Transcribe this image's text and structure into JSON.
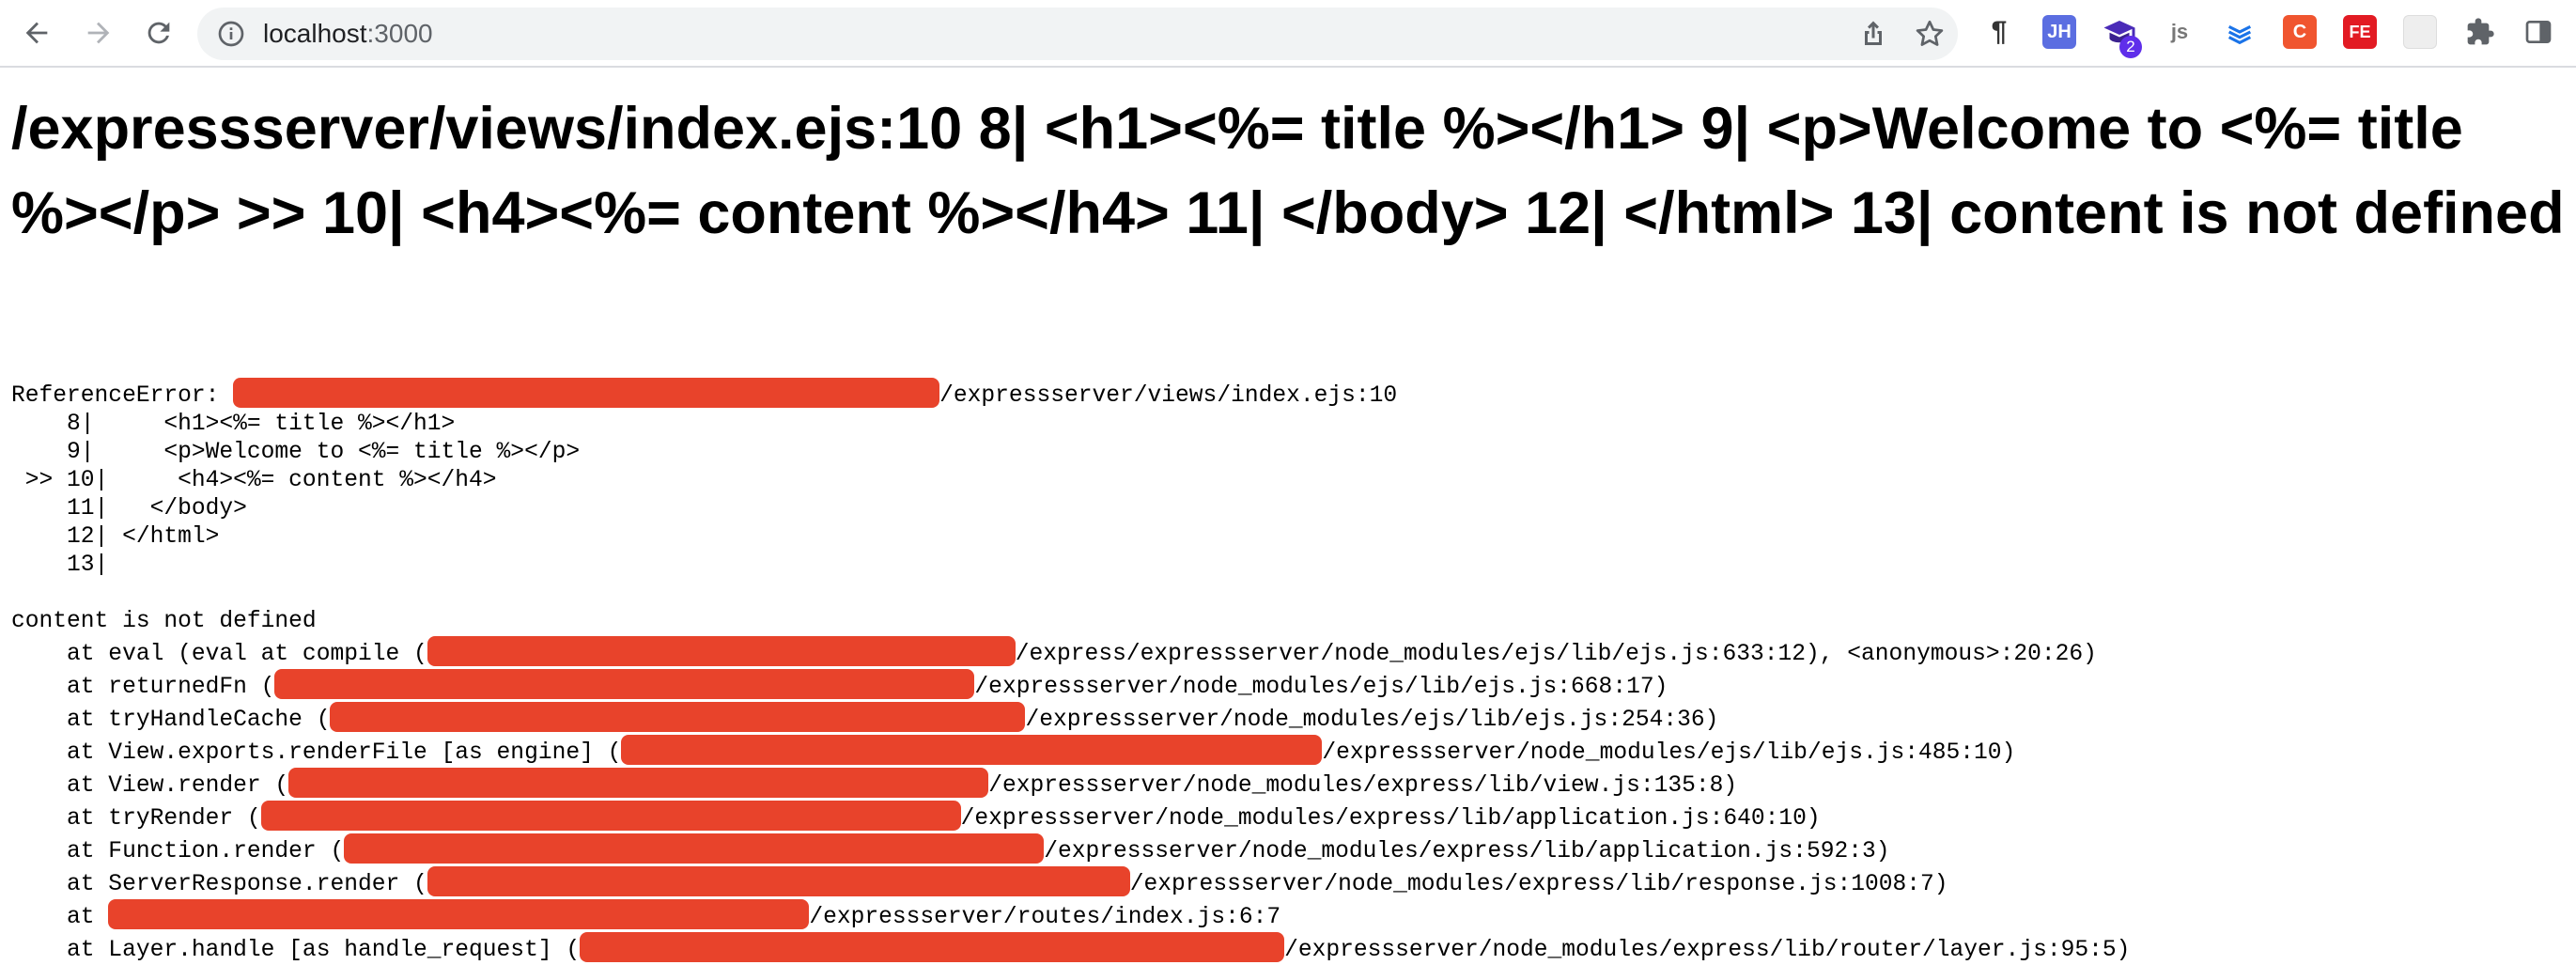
{
  "browser": {
    "url_host": "localhost",
    "url_port": ":3000",
    "extension_badge": "2",
    "extensions": [
      {
        "name": "pilcrow-icon",
        "label": "¶",
        "color": "#e8710a"
      },
      {
        "name": "jh-icon",
        "label": "JH",
        "color": "#5b6ee1"
      },
      {
        "name": "graduation-cap-icon",
        "label": "",
        "color": "#5f2eea"
      },
      {
        "name": "js-icon",
        "label": "js",
        "color": "#888888"
      },
      {
        "name": "layers-icon",
        "label": "",
        "color": "#1a73e8"
      },
      {
        "name": "c-icon",
        "label": "C",
        "color": "#f0552f"
      },
      {
        "name": "fe-icon",
        "label": "FE",
        "color": "#e21b23"
      },
      {
        "name": "grid-icon",
        "label": "",
        "color": "#dddddd"
      }
    ]
  },
  "error": {
    "title": "/expressserver/views/index.ejs:10 8| <h1><%= title %></h1> 9| <p>Welcome to <%= title %></p> >> 10| <h4><%= content %></h4> 11| </body> 12| </html> 13| content is not defined",
    "reference_prefix": "ReferenceError: ",
    "reference_suffix": "/expressserver/views/index.ejs:10",
    "code_lines": [
      "    8|     <h1><%= title %></h1>",
      "    9|     <p>Welcome to <%= title %></p>",
      " >> 10|     <h4><%= content %></h4>",
      "    11|   </body>",
      "    12| </html>",
      "    13|"
    ],
    "message": "content is not defined",
    "stack": [
      {
        "prefix": "    at eval (eval at compile (",
        "suffix": "/express/expressserver/node_modules/ejs/lib/ejs.js:633:12), <anonymous>:20:26)"
      },
      {
        "prefix": "    at returnedFn (",
        "suffix": "/expressserver/node_modules/ejs/lib/ejs.js:668:17)"
      },
      {
        "prefix": "    at tryHandleCache (",
        "suffix": "/expressserver/node_modules/ejs/lib/ejs.js:254:36)"
      },
      {
        "prefix": "    at View.exports.renderFile [as engine] (",
        "suffix": "/expressserver/node_modules/ejs/lib/ejs.js:485:10)"
      },
      {
        "prefix": "    at View.render (",
        "suffix": "/expressserver/node_modules/express/lib/view.js:135:8)"
      },
      {
        "prefix": "    at tryRender (",
        "suffix": "/expressserver/node_modules/express/lib/application.js:640:10)"
      },
      {
        "prefix": "    at Function.render (",
        "suffix": "/expressserver/node_modules/express/lib/application.js:592:3)"
      },
      {
        "prefix": "    at ServerResponse.render (",
        "suffix": "/expressserver/node_modules/express/lib/response.js:1008:7)"
      },
      {
        "prefix": "    at ",
        "suffix": "/expressserver/routes/index.js:6:7"
      },
      {
        "prefix": "    at Layer.handle [as handle_request] (",
        "suffix": "/expressserver/node_modules/express/lib/router/layer.js:95:5)"
      }
    ],
    "redaction_color": "#e8432b"
  }
}
